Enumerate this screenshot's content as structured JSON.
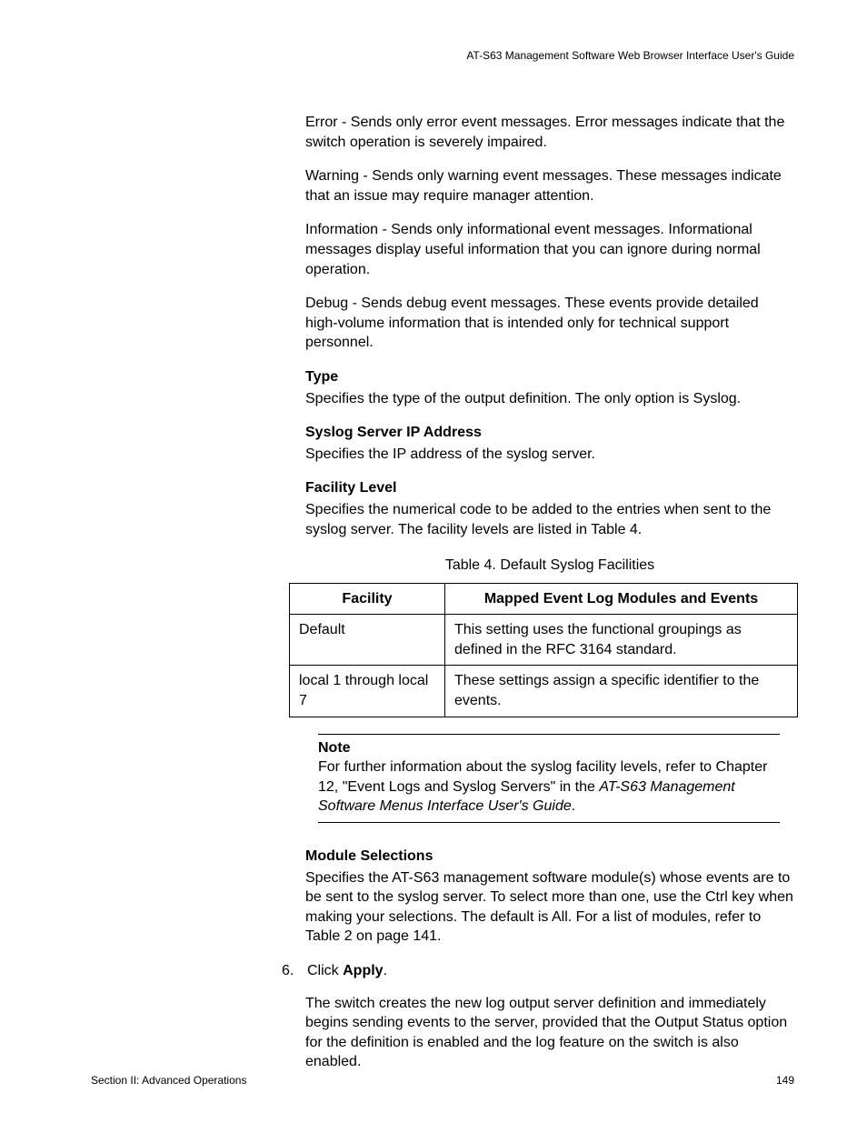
{
  "runningHeader": "AT-S63 Management Software Web Browser Interface User's Guide",
  "paragraphs": {
    "error": "Error - Sends only error event messages. Error messages indicate that the switch operation is severely impaired.",
    "warning": "Warning - Sends only warning event messages. These messages indicate that an issue may require manager attention.",
    "information": "Information - Sends only informational event messages. Informational messages display useful information that you can ignore during normal operation.",
    "debug": "Debug - Sends debug event messages. These events provide detailed high-volume information that is intended only for technical support personnel."
  },
  "type": {
    "heading": "Type",
    "text": "Specifies the type of the output definition. The only option is Syslog."
  },
  "syslogIp": {
    "heading": "Syslog Server IP Address",
    "text": "Specifies the IP address of the syslog server."
  },
  "facilityLevel": {
    "heading": "Facility Level",
    "text": "Specifies the numerical code to be added to the entries when sent to the syslog server. The facility levels are listed in Table 4."
  },
  "tableCaption": "Table 4. Default Syslog Facilities",
  "table": {
    "headers": [
      "Facility",
      "Mapped Event Log Modules and Events"
    ],
    "rows": [
      [
        "Default",
        "This setting uses the functional groupings as defined in the RFC 3164 standard."
      ],
      [
        "local 1 through local 7",
        "These settings assign a specific identifier to the events."
      ]
    ]
  },
  "note": {
    "label": "Note",
    "textBeforeItalic": "For further information about the syslog facility levels, refer to Chapter 12, \"Event Logs and Syslog Servers\" in the ",
    "italicText": "AT-S63 Management Software Menus Interface User's Guide",
    "textAfter": "."
  },
  "moduleSelections": {
    "heading": "Module Selections",
    "text": "Specifies the AT-S63 management software module(s) whose events are to be sent to the syslog server. To select more than one, use the Ctrl key when making your selections. The default is All. For a list of modules, refer to Table 2 on page 141."
  },
  "step6": {
    "num": "6.",
    "prefix": "Click ",
    "bold": "Apply",
    "suffix": "."
  },
  "stepResult": "The switch creates the new log output server definition and immediately begins sending events to the server, provided that the Output Status option for the definition is enabled and the log feature on the switch is also enabled.",
  "footer": {
    "left": "Section II: Advanced Operations",
    "right": "149"
  }
}
